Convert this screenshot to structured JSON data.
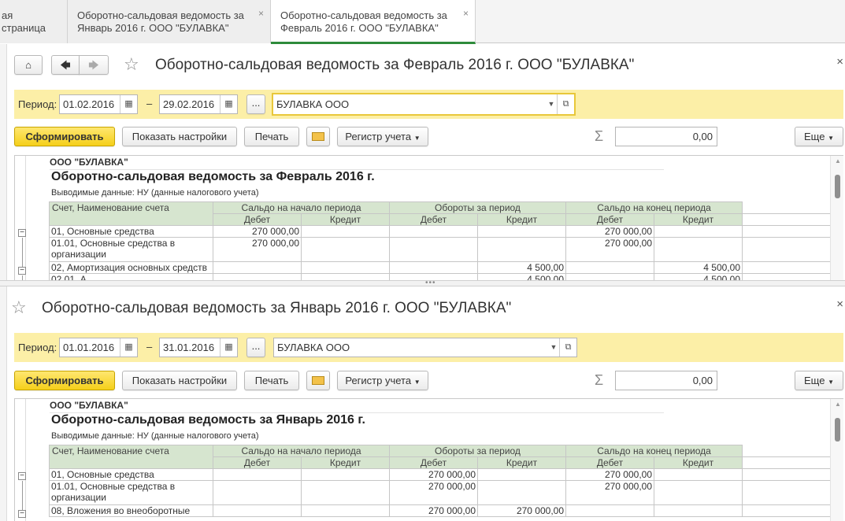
{
  "tabs": [
    {
      "label": "ая страница"
    },
    {
      "label_line1": "Оборотно-сальдовая ведомость за",
      "label_line2": "Январь 2016 г. ООО \"БУЛАВКА\""
    },
    {
      "label_line1": "Оборотно-сальдовая ведомость за",
      "label_line2": "Февраль 2016 г. ООО \"БУЛАВКА\""
    }
  ],
  "close_glyph": "×",
  "panes": [
    {
      "title": "Оборотно-сальдовая ведомость за Февраль 2016 г. ООО \"БУЛАВКА\"",
      "period_label": "Период:",
      "date_from": "01.02.2016",
      "date_to": "29.02.2016",
      "dash": "–",
      "ellipsis": "...",
      "organization": "БУЛАВКА ООО",
      "toolbar": {
        "generate": "Сформировать",
        "show_settings": "Показать настройки",
        "print": "Печать",
        "register": "Регистр учета",
        "sum_value": "0,00",
        "more": "Еще"
      },
      "report": {
        "org": "ООО \"БУЛАВКА\"",
        "title": "Оборотно-сальдовая ведомость за Февраль 2016 г.",
        "subtitle": "Выводимые данные:  НУ (данные налогового учета)",
        "header": {
          "account": "Счет, Наименование счета",
          "opening": "Сальдо на начало периода",
          "turnover": "Обороты за период",
          "closing": "Сальдо на конец периода",
          "debit": "Дебет",
          "credit": "Кредит"
        },
        "rows": [
          {
            "name": "01, Основные средства",
            "name2": "",
            "o_d": "270 000,00",
            "o_c": "",
            "t_d": "",
            "t_c": "",
            "c_d": "270 000,00",
            "c_c": ""
          },
          {
            "name": " 01.01, Основные средства в",
            "name2": " организации",
            "o_d": "270 000,00",
            "o_c": "",
            "t_d": "",
            "t_c": "",
            "c_d": "270 000,00",
            "c_c": ""
          },
          {
            "name": "02, Амортизация основных средств",
            "name2": "",
            "o_d": "",
            "o_c": "",
            "t_d": "",
            "t_c": "4 500,00",
            "c_d": "",
            "c_c": "4 500,00"
          },
          {
            "name": " 02.01, А",
            "name2": "",
            "o_d": "",
            "o_c": "",
            "t_d": "",
            "t_c": "4 500,00",
            "c_d": "",
            "c_c": "4 500,00"
          }
        ]
      }
    },
    {
      "title": "Оборотно-сальдовая ведомость за Январь 2016 г. ООО \"БУЛАВКА\"",
      "period_label": "Период:",
      "date_from": "01.01.2016",
      "date_to": "31.01.2016",
      "dash": "–",
      "ellipsis": "...",
      "organization": "БУЛАВКА ООО",
      "toolbar": {
        "generate": "Сформировать",
        "show_settings": "Показать настройки",
        "print": "Печать",
        "register": "Регистр учета",
        "sum_value": "0,00",
        "more": "Еще"
      },
      "report": {
        "org": "ООО \"БУЛАВКА\"",
        "title": "Оборотно-сальдовая ведомость за Январь 2016 г.",
        "subtitle": "Выводимые данные:  НУ (данные налогового учета)",
        "header": {
          "account": "Счет, Наименование счета",
          "opening": "Сальдо на начало периода",
          "turnover": "Обороты за период",
          "closing": "Сальдо на конец периода",
          "debit": "Дебет",
          "credit": "Кредит"
        },
        "rows": [
          {
            "name": "01, Основные средства",
            "name2": "",
            "o_d": "",
            "o_c": "",
            "t_d": "270 000,00",
            "t_c": "",
            "c_d": "270 000,00",
            "c_c": ""
          },
          {
            "name": " 01.01, Основные средства в",
            "name2": " организации",
            "o_d": "",
            "o_c": "",
            "t_d": "270 000,00",
            "t_c": "",
            "c_d": "270 000,00",
            "c_c": ""
          },
          {
            "name": "08, Вложения во внеоборотные",
            "name2": "",
            "o_d": "",
            "o_c": "",
            "t_d": "270 000,00",
            "t_c": "270 000,00",
            "c_d": "",
            "c_c": ""
          }
        ]
      }
    }
  ]
}
